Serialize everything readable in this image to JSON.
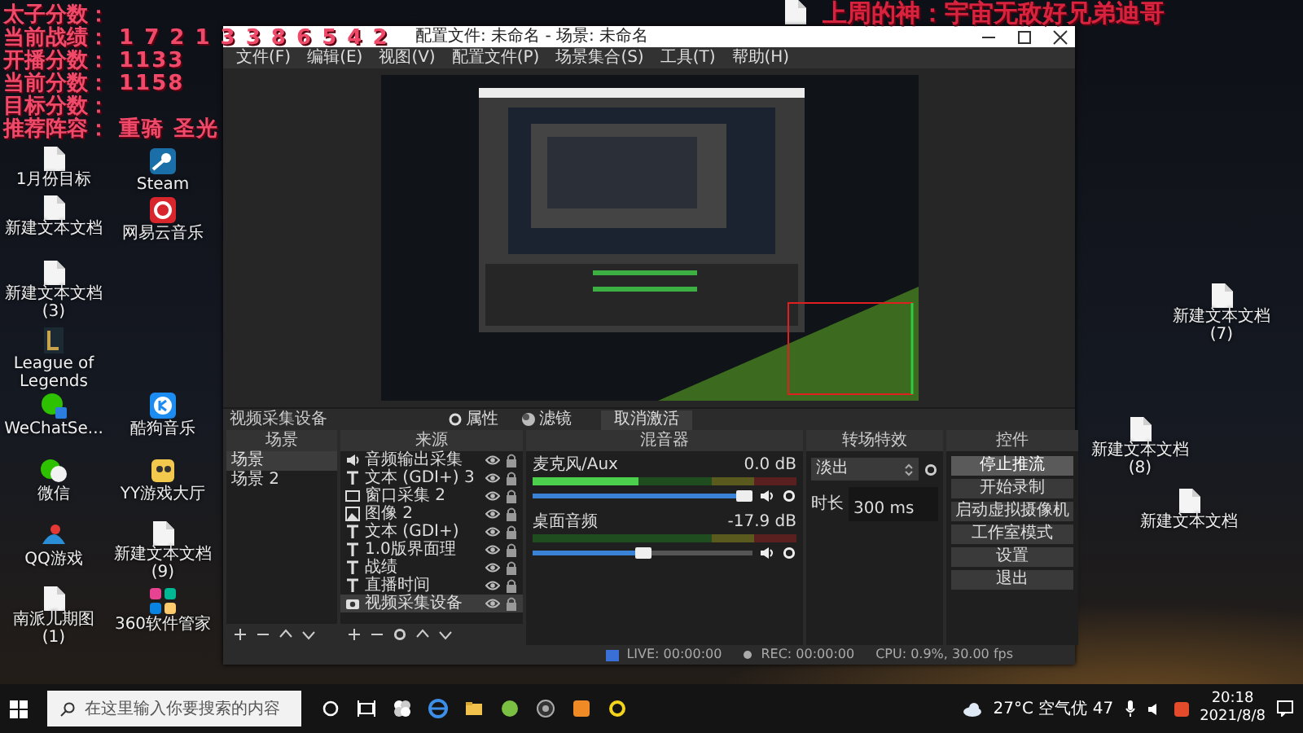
{
  "overlay": {
    "lines": [
      {
        "label": "太子分数："
      },
      {
        "label": "当前战绩：",
        "value": "1 7 2 1 3 3 8 6 5 4 2"
      },
      {
        "label": "开播分数：",
        "value": "1133"
      },
      {
        "label": "当前分数：",
        "value": "1158"
      },
      {
        "label": "目标分数："
      },
      {
        "label": "推荐阵容：",
        "value": "重骑 圣光"
      }
    ],
    "banner": "上周的神：宇宙无敌好兄弟迪哥"
  },
  "desktop_icons": [
    {
      "kind": "app",
      "label": "Steam"
    },
    {
      "kind": "file",
      "label": "1月份目标"
    },
    {
      "kind": "file",
      "label": "新建文本文档"
    },
    {
      "kind": "app",
      "label": "网易云音乐"
    },
    {
      "kind": "file",
      "label": "新建文本文档 (3)"
    },
    {
      "kind": "app",
      "label": "League of Legends"
    },
    {
      "kind": "app",
      "label": "WeChatSe..."
    },
    {
      "kind": "app",
      "label": "酷狗音乐"
    },
    {
      "kind": "app",
      "label": "微信"
    },
    {
      "kind": "app",
      "label": "YY游戏大厅"
    },
    {
      "kind": "app",
      "label": "QQ游戏"
    },
    {
      "kind": "file",
      "label": "新建文本文档 (9)"
    },
    {
      "kind": "file",
      "label": "南派儿期图 (1)"
    },
    {
      "kind": "app",
      "label": "360软件管家"
    },
    {
      "kind": "file"
    },
    {
      "kind": "file",
      "label": "新建文本文档 (7)"
    },
    {
      "kind": "file",
      "label": "新建文本文档 (8)"
    },
    {
      "kind": "file",
      "label": "新建文本文档"
    }
  ],
  "obs": {
    "title": "配置文件: 未命名 - 场景: 未命名",
    "menu": [
      "文件(F)",
      "编辑(E)",
      "视图(V)",
      "配置文件(P)",
      "场景集合(S)",
      "工具(T)",
      "帮助(H)"
    ],
    "source_bar": {
      "label": "视频采集设备",
      "buttons": [
        "属性",
        "滤镜",
        "取消激活"
      ]
    },
    "scenes": {
      "title": "场景",
      "items": [
        {
          "label": "场景",
          "selected": true
        },
        {
          "label": "场景 2",
          "selected": false
        }
      ]
    },
    "sources": {
      "title": "来源",
      "items": [
        {
          "kind": "audio",
          "label": "音频输出采集",
          "selected": false
        },
        {
          "kind": "text",
          "label": "文本 (GDI+) 3",
          "selected": false
        },
        {
          "kind": "window",
          "label": "窗口采集 2",
          "selected": false
        },
        {
          "kind": "image",
          "label": "图像 2",
          "selected": false
        },
        {
          "kind": "text",
          "label": "文本 (GDI+)",
          "selected": false
        },
        {
          "kind": "text",
          "label": "1.0版界面理",
          "selected": false
        },
        {
          "kind": "text",
          "label": "战绩",
          "selected": false
        },
        {
          "kind": "text",
          "label": "直播时间",
          "selected": false
        },
        {
          "kind": "camera",
          "label": "视频采集设备",
          "selected": true
        }
      ]
    },
    "mixer": {
      "title": "混音器",
      "channels": [
        {
          "name": "麦克风/Aux",
          "reading": "0.0 dB",
          "meter": {
            "level": 0.4
          },
          "volume": {
            "level": 0.96
          }
        },
        {
          "name": "桌面音频",
          "reading": "-17.9 dB",
          "meter": {
            "level": 0.0
          },
          "volume": {
            "level": 0.5
          }
        }
      ]
    },
    "transitions": {
      "title": "转场特效",
      "type": "淡出",
      "duration_label": "时长",
      "duration": "300 ms"
    },
    "controls": {
      "title": "控件",
      "buttons": [
        {
          "label": "停止推流",
          "on": true
        },
        {
          "label": "开始录制",
          "on": false
        },
        {
          "label": "启动虚拟摄像机",
          "on": false
        },
        {
          "label": "工作室模式",
          "on": false
        },
        {
          "label": "设置",
          "on": false
        },
        {
          "label": "退出",
          "on": false
        }
      ]
    },
    "status": {
      "live": "LIVE: 00:00:00",
      "rec": "REC: 00:00:00",
      "cpu": "CPU: 0.9%, 30.00 fps"
    }
  },
  "taskbar": {
    "search": {
      "placeholder": "在这里输入你要搜索的内容"
    },
    "weather": "27°C 空气优 47",
    "time": "20:18",
    "date": "2021/8/8"
  }
}
